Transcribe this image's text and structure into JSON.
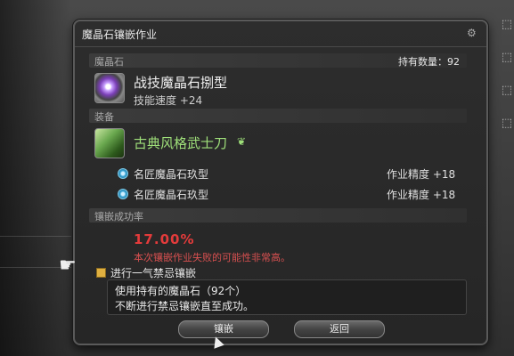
{
  "window": {
    "title": "魔晶石镶嵌作业"
  },
  "materia_section": {
    "label": "魔晶石",
    "count_label": "持有数量：92",
    "item_name": "战技魔晶石捌型",
    "item_stat": "技能速度 +24"
  },
  "equipment_section": {
    "label": "装备",
    "item_name": "古典风格武士刀",
    "hq_icon": "hq-icon",
    "slots": [
      {
        "name": "名匠魔晶石玖型",
        "stat": "作业精度 +18"
      },
      {
        "name": "名匠魔晶石玖型",
        "stat": "作业精度 +18"
      }
    ]
  },
  "success_section": {
    "label": "镶嵌成功率",
    "rate": "17.00%",
    "warning": "本次镶嵌作业失败的可能性非常高。"
  },
  "overmeld": {
    "checkbox_label": "进行一气禁忌镶嵌",
    "description_lines": [
      "使用持有的魔晶石（92个）",
      "不断进行禁忌镶嵌直至成功。"
    ]
  },
  "buttons": {
    "meld": "镶嵌",
    "back": "返回"
  },
  "colors": {
    "rate_red": "#e33b3b",
    "hq_green": "#9fe07a",
    "checkbox_gold": "#e0b040"
  }
}
